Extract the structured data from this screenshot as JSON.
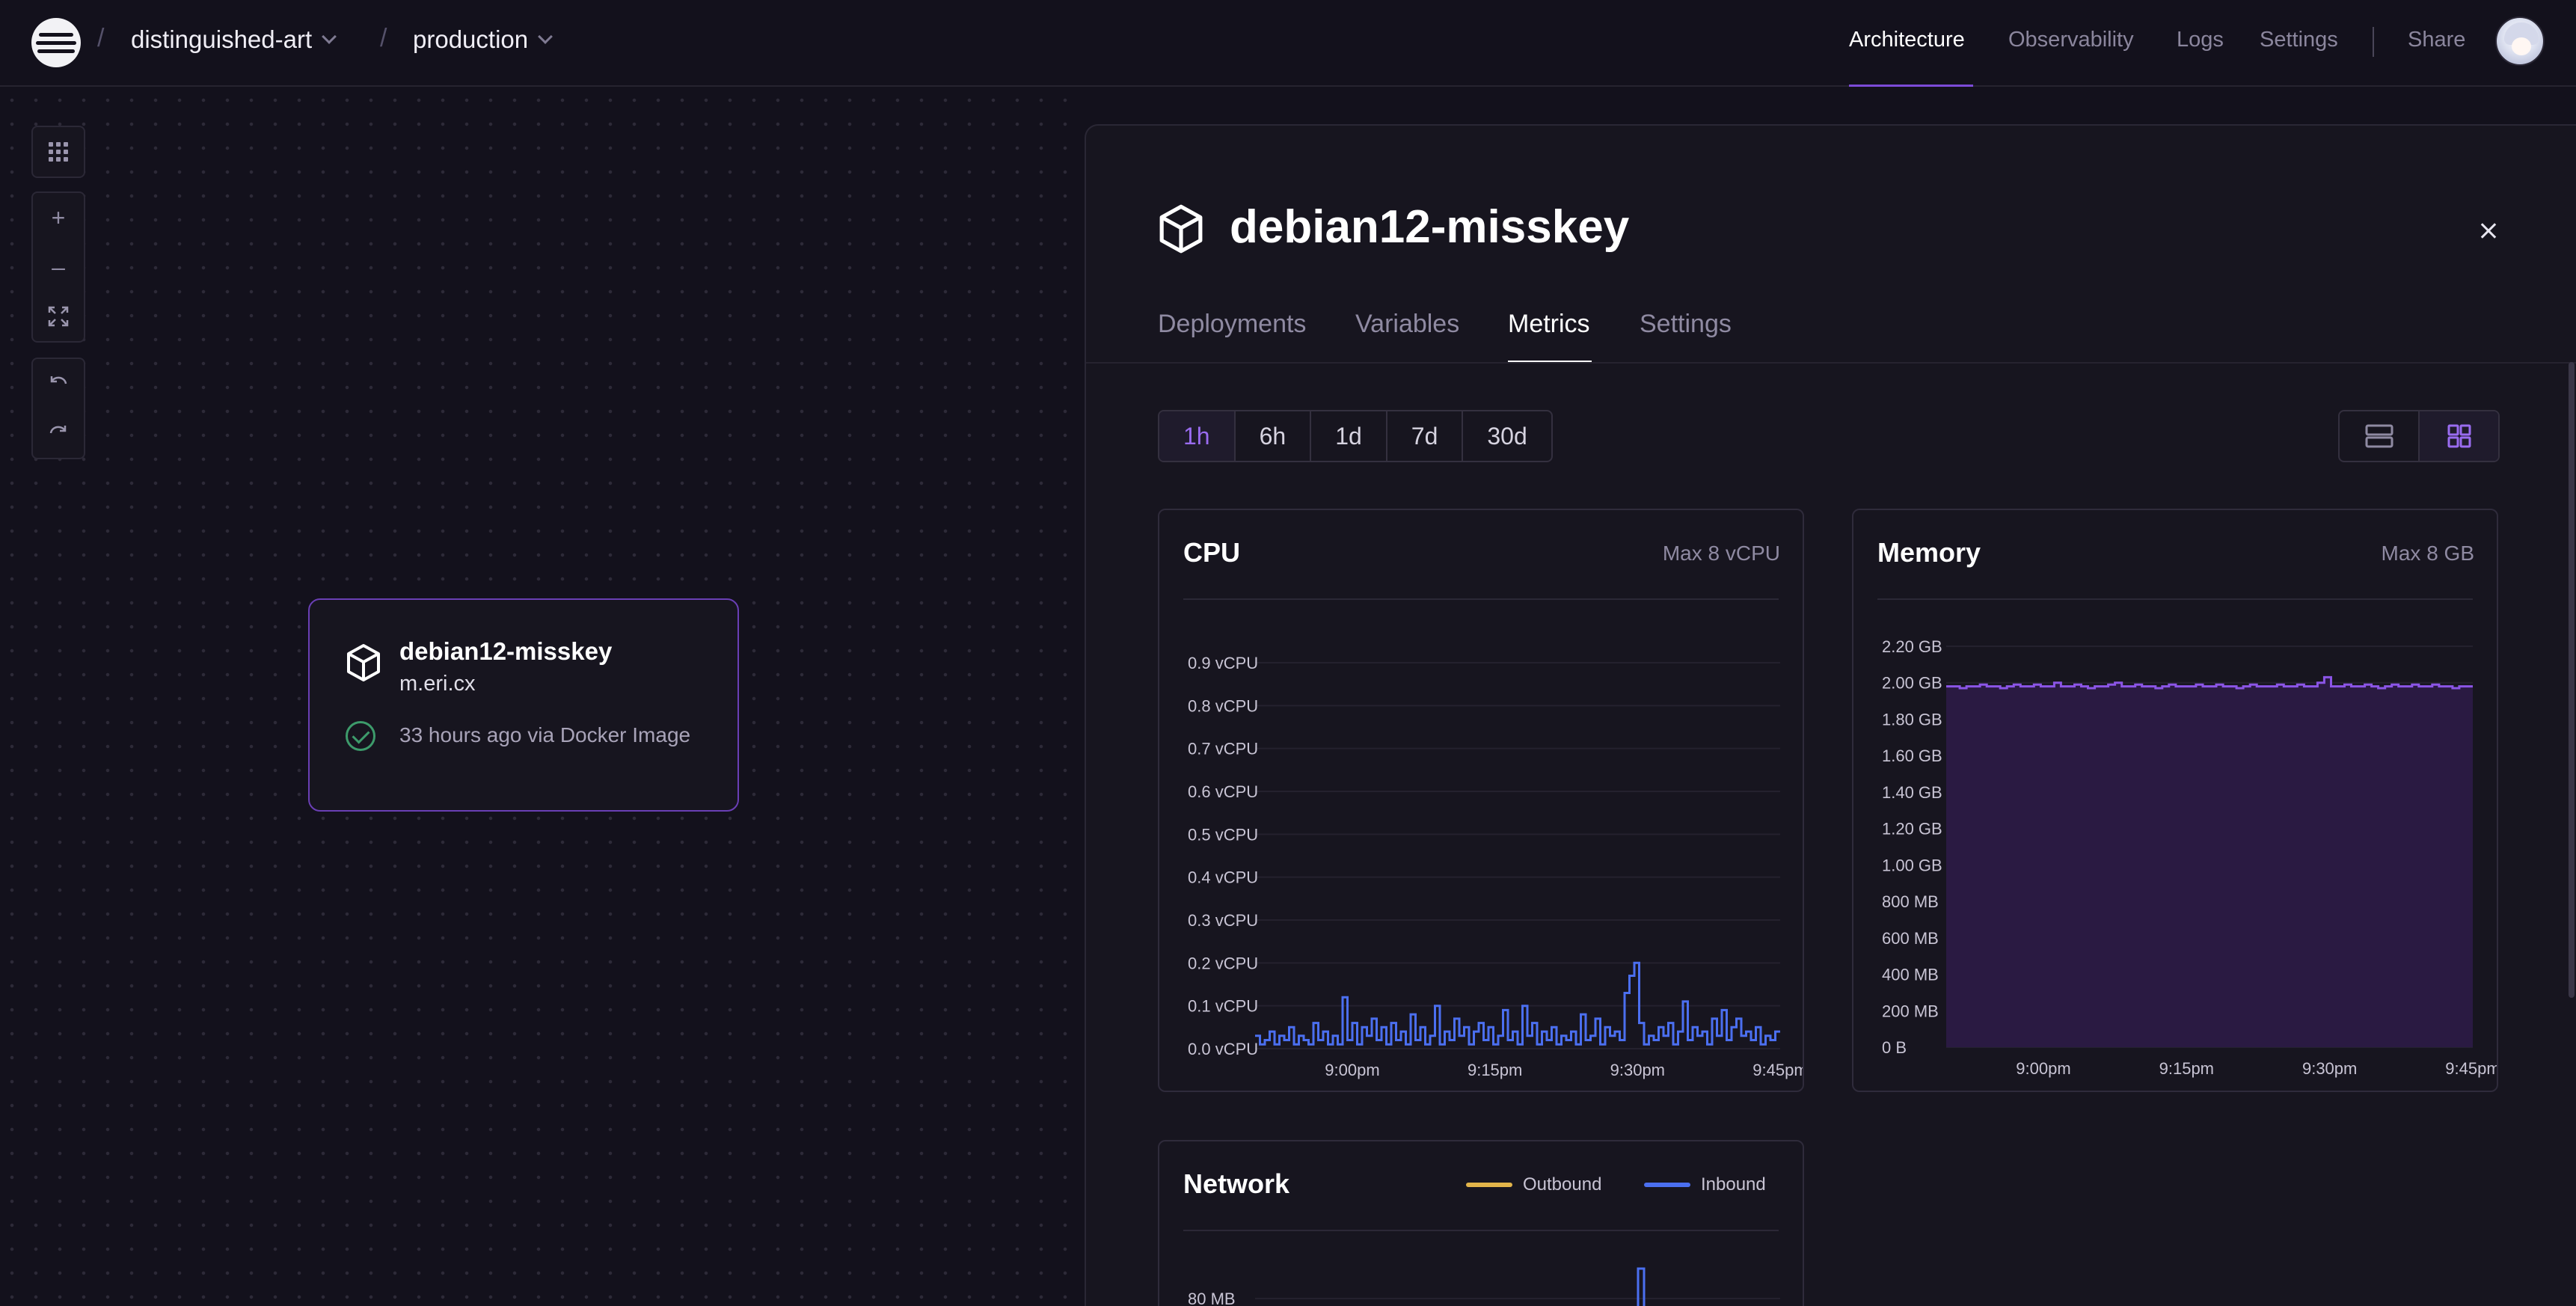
{
  "breadcrumb": {
    "project": "distinguished-art",
    "environment": "production",
    "separator": "/"
  },
  "nav": {
    "architecture": "Architecture",
    "observability": "Observability",
    "logs": "Logs",
    "settings": "Settings",
    "share": "Share"
  },
  "canvas_tools": {
    "zoom_in": "+",
    "zoom_out": "–"
  },
  "service_card": {
    "name": "debian12-misskey",
    "domain": "m.eri.cx",
    "status": "33 hours ago via Docker Image"
  },
  "panel": {
    "title": "debian12-misskey",
    "tabs": [
      "Deployments",
      "Variables",
      "Metrics",
      "Settings"
    ],
    "active_tab": "Metrics",
    "time_ranges": [
      "1h",
      "6h",
      "1d",
      "7d",
      "30d"
    ],
    "selected_range": "1h"
  },
  "colors": {
    "accent": "#7c4bd8",
    "cpu_line": "#4b6ff0",
    "memory_line": "#8b55e6",
    "memory_fill": "#2a1a42",
    "outbound": "#e2b44a",
    "inbound": "#4b6ff0",
    "success": "#3d9b6b"
  },
  "chart_data": [
    {
      "type": "line",
      "title": "CPU",
      "max_label": "Max 8 vCPU",
      "y_ticks": [
        "0.0 vCPU",
        "0.1 vCPU",
        "0.2 vCPU",
        "0.3 vCPU",
        "0.4 vCPU",
        "0.5 vCPU",
        "0.6 vCPU",
        "0.7 vCPU",
        "0.8 vCPU",
        "0.9 vCPU"
      ],
      "x_ticks": [
        "9:00pm",
        "9:15pm",
        "9:30pm",
        "9:45pm"
      ],
      "ylim": [
        0,
        0.9
      ],
      "series": [
        {
          "values": [
            0.03,
            0.01,
            0.02,
            0.04,
            0.01,
            0.03,
            0.02,
            0.05,
            0.01,
            0.03,
            0.02,
            0.01,
            0.06,
            0.02,
            0.04,
            0.01,
            0.03,
            0.01,
            0.12,
            0.02,
            0.06,
            0.01,
            0.05,
            0.03,
            0.07,
            0.02,
            0.05,
            0.01,
            0.06,
            0.02,
            0.04,
            0.01,
            0.08,
            0.02,
            0.05,
            0.01,
            0.03,
            0.1,
            0.01,
            0.04,
            0.02,
            0.07,
            0.03,
            0.05,
            0.01,
            0.04,
            0.06,
            0.02,
            0.05,
            0.01,
            0.03,
            0.09,
            0.02,
            0.04,
            0.01,
            0.1,
            0.03,
            0.06,
            0.01,
            0.04,
            0.02,
            0.05,
            0.01,
            0.03,
            0.02,
            0.04,
            0.01,
            0.08,
            0.02,
            0.03,
            0.07,
            0.01,
            0.05,
            0.03,
            0.04,
            0.02,
            0.13,
            0.17,
            0.2,
            0.06,
            0.01,
            0.03,
            0.02,
            0.05,
            0.03,
            0.06,
            0.01,
            0.04,
            0.11,
            0.02,
            0.05,
            0.03,
            0.04,
            0.01,
            0.07,
            0.03,
            0.09,
            0.02,
            0.05,
            0.07,
            0.03,
            0.04,
            0.02,
            0.05,
            0.01,
            0.03,
            0.02,
            0.04
          ]
        }
      ]
    },
    {
      "type": "area",
      "title": "Memory",
      "max_label": "Max 8 GB",
      "y_ticks": [
        "0 B",
        "200 MB",
        "400 MB",
        "600 MB",
        "800 MB",
        "1.00 GB",
        "1.20 GB",
        "1.40 GB",
        "1.60 GB",
        "1.80 GB",
        "2.00 GB",
        "2.20 GB"
      ],
      "x_ticks": [
        "9:00pm",
        "9:15pm",
        "9:30pm",
        "9:45pm"
      ],
      "ylim": [
        0,
        2.2
      ],
      "series": [
        {
          "values": [
            1.98,
            1.98,
            1.97,
            1.98,
            1.98,
            1.99,
            1.98,
            1.98,
            1.97,
            1.98,
            1.99,
            1.98,
            1.98,
            1.99,
            1.98,
            1.98,
            2.0,
            1.98,
            1.98,
            1.99,
            1.98,
            1.97,
            1.98,
            1.98,
            1.99,
            2.0,
            1.98,
            1.98,
            1.99,
            1.98,
            1.98,
            1.97,
            1.98,
            1.99,
            1.98,
            1.98,
            1.98,
            1.99,
            1.98,
            1.98,
            1.99,
            1.98,
            1.98,
            1.97,
            1.98,
            1.99,
            1.98,
            1.98,
            1.98,
            1.99,
            1.98,
            1.98,
            1.99,
            1.98,
            1.98,
            2.0,
            2.03,
            1.98,
            1.98,
            1.99,
            1.98,
            1.98,
            1.99,
            1.98,
            1.97,
            1.98,
            1.99,
            1.98,
            1.98,
            1.99,
            1.98,
            1.98,
            1.99,
            1.98,
            1.98,
            1.97,
            1.98,
            1.98
          ]
        }
      ]
    },
    {
      "type": "line",
      "title": "Network",
      "y_ticks": [
        "80 MB"
      ],
      "legend": [
        "Outbound",
        "Inbound"
      ]
    }
  ]
}
